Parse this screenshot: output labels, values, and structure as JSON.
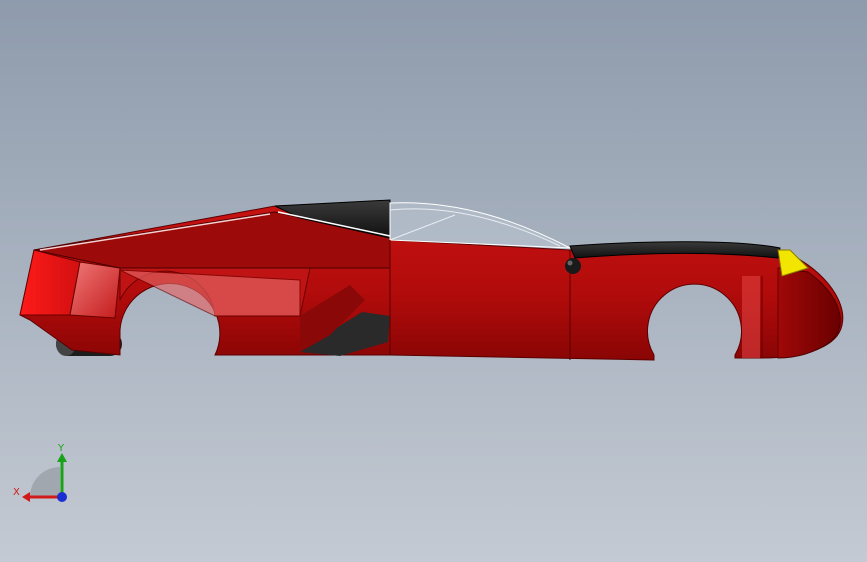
{
  "viewport": {
    "background_top": "#8e9bac",
    "background_bottom": "#c4cad3"
  },
  "model": {
    "body_color": "#b80d0d",
    "body_shadow": "#7a0000",
    "body_highlight": "#e85a5a",
    "roof_color": "#1e1e1e",
    "light_color": "#f2e600",
    "glass_color": "#c9d0dc"
  },
  "triad": {
    "x_label": "X",
    "y_label": "Y",
    "x_color": "#d11a1a",
    "y_color": "#1aa31a",
    "z_color": "#1a2ed1"
  }
}
